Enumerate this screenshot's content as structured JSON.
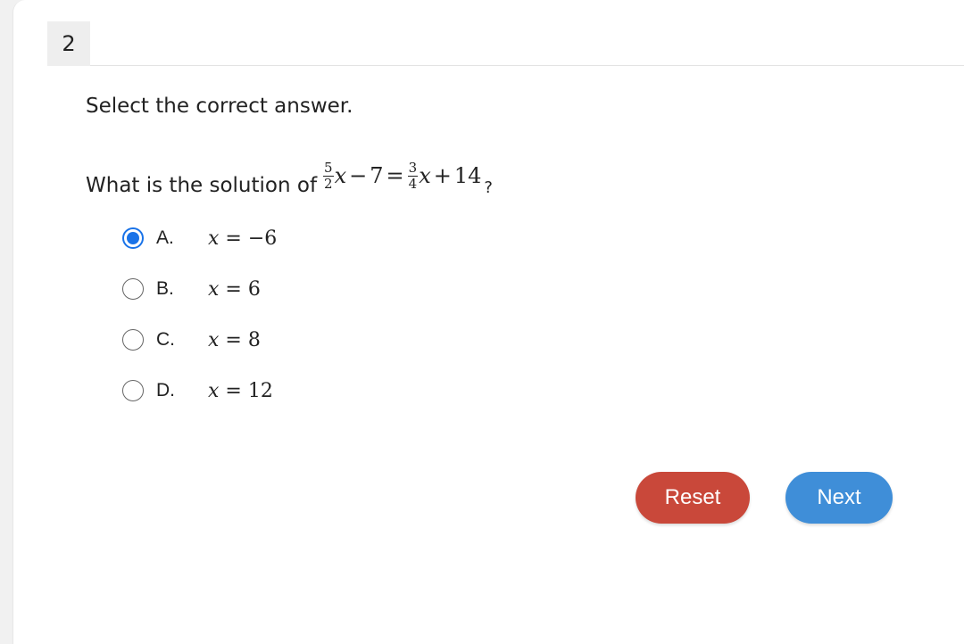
{
  "question_number": "2",
  "instruction": "Select the correct answer.",
  "question": {
    "prefix": "What is the solution of",
    "equation": {
      "lhs_num": "5",
      "lhs_den": "2",
      "lhs_var": "x",
      "lhs_op": "−",
      "lhs_const": "7",
      "eq": "=",
      "rhs_num": "3",
      "rhs_den": "4",
      "rhs_var": "x",
      "rhs_op": "+",
      "rhs_const": "14"
    },
    "suffix": "?"
  },
  "options": [
    {
      "letter": "A.",
      "var": "x",
      "eq": "=",
      "value": "−6",
      "selected": true
    },
    {
      "letter": "B.",
      "var": "x",
      "eq": "=",
      "value": "6",
      "selected": false
    },
    {
      "letter": "C.",
      "var": "x",
      "eq": "=",
      "value": "8",
      "selected": false
    },
    {
      "letter": "D.",
      "var": "x",
      "eq": "=",
      "value": "12",
      "selected": false
    }
  ],
  "buttons": {
    "reset": "Reset",
    "next": "Next"
  },
  "colors": {
    "reset": "#c9483a",
    "next": "#3f8ed8",
    "radio_selected": "#1a73e8"
  }
}
